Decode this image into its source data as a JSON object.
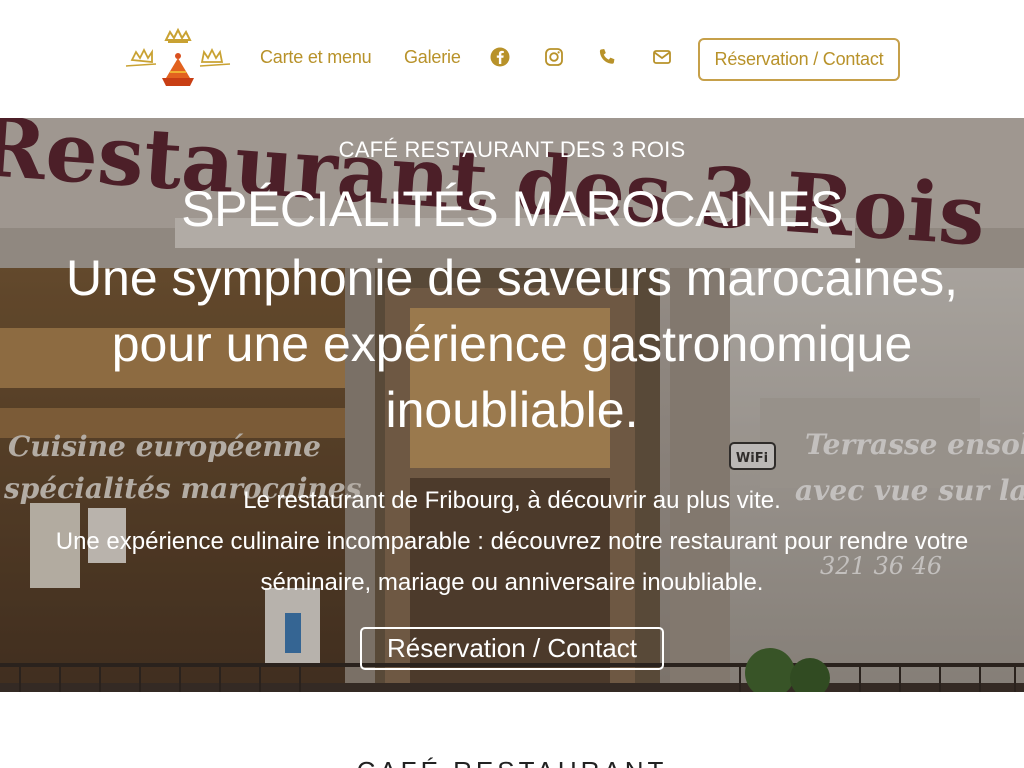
{
  "header": {
    "logo_icon": "crowns-tajine-logo",
    "nav": [
      {
        "label": "Carte et menu"
      },
      {
        "label": "Galerie"
      }
    ],
    "social_icons": [
      "facebook-icon",
      "instagram-icon",
      "phone-icon",
      "mail-icon"
    ],
    "cta_label": "Réservation / Contact",
    "accent_color": "#b8922a"
  },
  "hero": {
    "kicker": "CAFÉ RESTAURANT DES 3 ROIS",
    "title": "SPÉCIALITÉS MAROCAINES",
    "tagline": "Une symphonie de saveurs marocaines, pour une expérience gastronomique inoubliable.",
    "text_line1": "Le restaurant de Fribourg, à découvrir au plus vite.",
    "text_line2": "Une expérience culinaire incomparable : découvrez notre restaurant pour rendre votre séminaire, mariage ou anniversaire inoubliable.",
    "cta_label": "Réservation / Contact",
    "storefront": {
      "sign": "Restaurant des 3 Rois",
      "window_left_1": "Cuisine européenne",
      "window_left_2": "spécialités marocaines",
      "window_right_1": "Terrasse ensoleillée",
      "window_right_2": "avec vue sur la",
      "phone_fragment": "321 36 46",
      "wifi": "WiFi"
    }
  },
  "section": {
    "heading": "CAFÉ RESTAURANT"
  }
}
